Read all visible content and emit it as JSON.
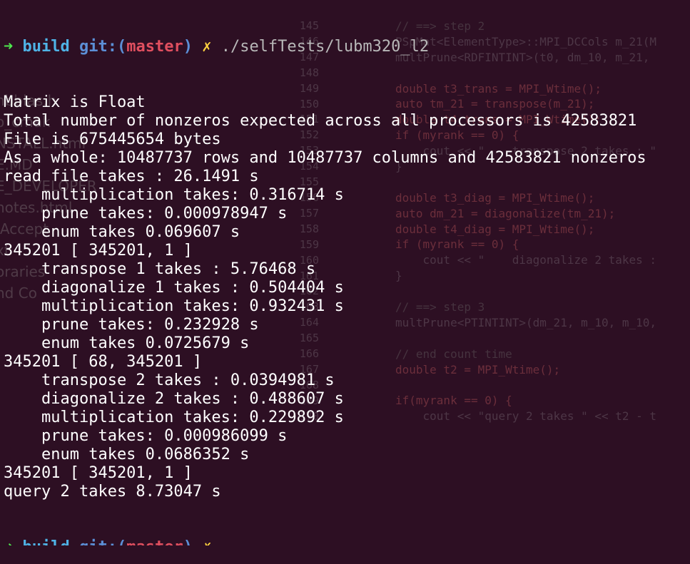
{
  "background_editor": {
    "sidebar": [
      "nbblas.h",
      "o_cmak",
      "NSTALL.html",
      "E.MD",
      "E_DEVELOPER",
      "notes.html",
      "IAccept",
      "xt",
      "oraries",
      "nd Co"
    ],
    "line_numbers": [
      "145",
      "146",
      "147",
      "148",
      "149",
      "150",
      "151",
      "152",
      "153",
      "154",
      "155",
      "156",
      "157",
      "158",
      "159",
      "160",
      "161",
      "162",
      "163",
      "164",
      "165",
      "166",
      "167",
      "168",
      "169",
      "170"
    ],
    "code_lines": [
      "// ==> step 2",
      "PSpMat<ElementType>::MPI_DCCols m_21(M",
      "multPrune<RDFINTINT>(t0, dm_10, m_21,",
      "",
      "double t3_trans = MPI_Wtime();",
      "auto tm_21 = transpose(m_21);",
      "double t4_trans = MPI_Wtime();",
      "if (myrank == 0) {",
      "    cout << \"    transpose 2 takes : \"",
      "}",
      "",
      "double t3_diag = MPI_Wtime();",
      "auto dm_21 = diagonalize(tm_21);",
      "double t4_diag = MPI_Wtime();",
      "if (myrank == 0) {",
      "    cout << \"    diagonalize 2 takes :",
      "}",
      "",
      "// ==> step 3",
      "multPrune<PTINTINT>(dm_21, m_10, m_10,",
      "",
      "// end count time",
      "double t2 = MPI_Wtime();",
      "",
      "if(myrank == 0) {",
      "    cout << \"query 2 takes \" << t2 - t"
    ]
  },
  "terminal": {
    "prompt": {
      "arrow": "➜",
      "dir": "build",
      "git_label": "git:(",
      "branch": "master",
      "git_close": ")",
      "dirty_mark": "✗",
      "command": "./selfTests/lubm320_l2"
    },
    "output": [
      "Matrix is Float",
      "Total number of nonzeros expected across all processors is 42583821",
      "File is 675445654 bytes",
      "As a whole: 10487737 rows and 10487737 columns and 42583821 nonzeros",
      "read file takes : 26.1491 s",
      "    multiplication takes: 0.316714 s",
      "    prune takes: 0.000978947 s",
      "    enum takes 0.069607 s",
      "345201 [ 345201, 1 ]",
      "    transpose 1 takes : 5.76468 s",
      "    diagonalize 1 takes : 0.504404 s",
      "    multiplication takes: 0.932431 s",
      "    prune takes: 0.232928 s",
      "    enum takes 0.0725679 s",
      "345201 [ 68, 345201 ]",
      "    transpose 2 takes : 0.0394981 s",
      "    diagonalize 2 takes : 0.488607 s",
      "    multiplication takes: 0.229892 s",
      "    prune takes: 0.000986099 s",
      "    enum takes 0.0686352 s",
      "345201 [ 345201, 1 ]",
      "query 2 takes 8.73047 s"
    ]
  },
  "colors": {
    "background": "#2d0f23",
    "text": "#ffffff",
    "arrow": "#4ee84e",
    "dir": "#4fb3e6",
    "branch": "#e04f5f",
    "dirty": "#ffd23f"
  }
}
